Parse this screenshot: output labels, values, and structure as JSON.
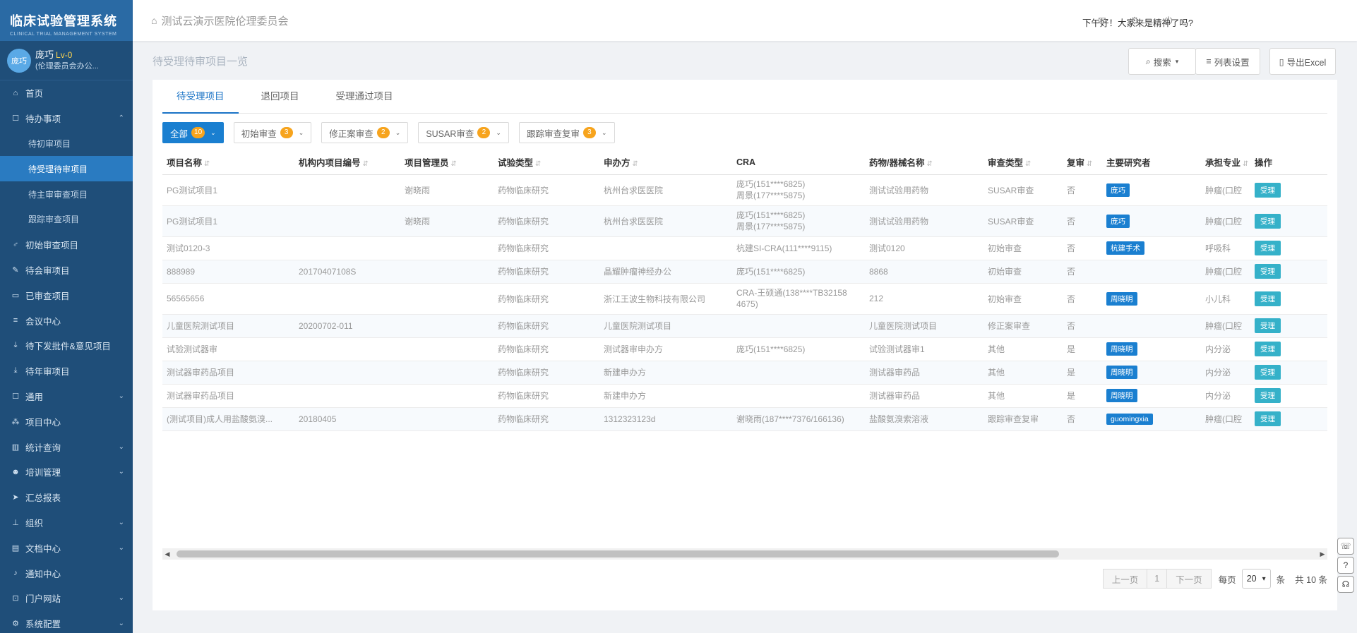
{
  "sidebar": {
    "brand_title": "临床试验管理系统",
    "brand_sub": "CLINICAL TRIAL MANAGEMENT SYSTEM",
    "user": {
      "avatar_text": "庞巧",
      "name": "庞巧",
      "level": "Lv-0",
      "dept": "(伦理委员会办公..."
    },
    "items": [
      {
        "label": "首页",
        "icon": "home-icon",
        "glyph": "⌂",
        "sub": false,
        "active": false,
        "chev": ""
      },
      {
        "label": "待办事项",
        "icon": "calendar-icon",
        "glyph": "☐",
        "sub": false,
        "active": false,
        "chev": "⌃"
      },
      {
        "label": "待初审项目",
        "icon": "",
        "glyph": "",
        "sub": true,
        "active": false,
        "chev": ""
      },
      {
        "label": "待受理待审项目",
        "icon": "",
        "glyph": "",
        "sub": true,
        "active": true,
        "chev": ""
      },
      {
        "label": "待主审审查项目",
        "icon": "",
        "glyph": "",
        "sub": true,
        "active": false,
        "chev": ""
      },
      {
        "label": "跟踪审查项目",
        "icon": "",
        "glyph": "",
        "sub": true,
        "active": false,
        "chev": ""
      },
      {
        "label": "初始审查项目",
        "icon": "male-icon",
        "glyph": "♂",
        "sub": false,
        "active": false,
        "chev": ""
      },
      {
        "label": "待会审项目",
        "icon": "hammer-icon",
        "glyph": "✎",
        "sub": false,
        "active": false,
        "chev": ""
      },
      {
        "label": "已审查项目",
        "icon": "monitor-icon",
        "glyph": "▭",
        "sub": false,
        "active": false,
        "chev": ""
      },
      {
        "label": "会议中心",
        "icon": "list-icon",
        "glyph": "≡",
        "sub": false,
        "active": false,
        "chev": ""
      },
      {
        "label": "待下发批件&意见项目",
        "icon": "download-icon",
        "glyph": "⤓",
        "sub": false,
        "active": false,
        "chev": ""
      },
      {
        "label": "待年审项目",
        "icon": "download-icon",
        "glyph": "⤓",
        "sub": false,
        "active": false,
        "chev": ""
      },
      {
        "label": "通用",
        "icon": "calendar-icon",
        "glyph": "☐",
        "sub": false,
        "active": false,
        "chev": "⌄"
      },
      {
        "label": "项目中心",
        "icon": "cluster-icon",
        "glyph": "⁂",
        "sub": false,
        "active": false,
        "chev": ""
      },
      {
        "label": "统计查询",
        "icon": "chart-icon",
        "glyph": "▥",
        "sub": false,
        "active": false,
        "chev": "⌄"
      },
      {
        "label": "培训管理",
        "icon": "users-icon",
        "glyph": "☻",
        "sub": false,
        "active": false,
        "chev": "⌄"
      },
      {
        "label": "汇总报表",
        "icon": "send-icon",
        "glyph": "➤",
        "sub": false,
        "active": false,
        "chev": ""
      },
      {
        "label": "组织",
        "icon": "sitemap-icon",
        "glyph": "⊥",
        "sub": false,
        "active": false,
        "chev": "⌄"
      },
      {
        "label": "文档中心",
        "icon": "document-icon",
        "glyph": "▤",
        "sub": false,
        "active": false,
        "chev": "⌄"
      },
      {
        "label": "通知中心",
        "icon": "bell-icon",
        "glyph": "♪",
        "sub": false,
        "active": false,
        "chev": ""
      },
      {
        "label": "门户网站",
        "icon": "portal-icon",
        "glyph": "⊡",
        "sub": false,
        "active": false,
        "chev": "⌄"
      },
      {
        "label": "系统配置",
        "icon": "cogs-icon",
        "glyph": "⚙",
        "sub": false,
        "active": false,
        "chev": "⌄"
      }
    ]
  },
  "header": {
    "org": "测试云演示医院伦理委员会",
    "greeting": "下午好！大家来是精神了吗?"
  },
  "page": {
    "title": "待受理待审项目一览",
    "search_label": "搜索",
    "columns_label": "列表设置",
    "export_label": "导出Excel"
  },
  "tabs": [
    "待受理项目",
    "退回项目",
    "受理通过项目"
  ],
  "filters": [
    {
      "label": "全部",
      "count": "10",
      "primary": true
    },
    {
      "label": "初始审查",
      "count": "3",
      "primary": false
    },
    {
      "label": "修正案审查",
      "count": "2",
      "primary": false
    },
    {
      "label": "SUSAR审查",
      "count": "2",
      "primary": false
    },
    {
      "label": "跟踪审查复审",
      "count": "3",
      "primary": false
    }
  ],
  "table": {
    "columns": [
      {
        "label": "项目名称",
        "sort": true
      },
      {
        "label": "机构内项目编号",
        "sort": true
      },
      {
        "label": "项目管理员",
        "sort": true
      },
      {
        "label": "试验类型",
        "sort": true
      },
      {
        "label": "申办方",
        "sort": true
      },
      {
        "label": "CRA",
        "sort": false
      },
      {
        "label": "药物/器械名称",
        "sort": true
      },
      {
        "label": "审查类型",
        "sort": true
      },
      {
        "label": "复审",
        "sort": true
      },
      {
        "label": "主要研究者",
        "sort": false
      },
      {
        "label": "承担专业",
        "sort": true
      },
      {
        "label": "操作",
        "sort": false
      }
    ],
    "rows": [
      [
        "PG测试项目1",
        "",
        "谢晓雨",
        "药物临床研究",
        "杭州台求医医院",
        "庞巧(151****6825)\n周景(177****5875)",
        "测试试验用药物",
        "SUSAR审查",
        "否",
        "庞巧",
        "肿瘤(口腔",
        "受理"
      ],
      [
        "PG测试项目1",
        "",
        "谢晓雨",
        "药物临床研究",
        "杭州台求医医院",
        "庞巧(151****6825)\n周景(177****5875)",
        "测试试验用药物",
        "SUSAR审查",
        "否",
        "庞巧",
        "肿瘤(口腔",
        "受理"
      ],
      [
        "测试0120-3",
        "",
        "",
        "药物临床研究",
        "",
        "杭建SI-CRA(111****9115)",
        "测试0120",
        "初始审查",
        "否",
        "杭建手术",
        "呼吸科",
        "受理"
      ],
      [
        "888989",
        "20170407108S",
        "",
        "药物临床研究",
        "晶耀肿瘤神经办公",
        "庞巧(151****6825)",
        "8868",
        "初始审查",
        "否",
        "",
        "肿瘤(口腔",
        "受理"
      ],
      [
        "56565656",
        "",
        "",
        "药物临床研究",
        "浙江王波生物科技有限公司",
        "CRA-王硕通(138****TB32158\n4675)",
        "212",
        "初始审查",
        "否",
        "周晓明",
        "小儿科",
        "受理"
      ],
      [
        "儿童医院测试项目",
        "20200702-011",
        "",
        "药物临床研究",
        "儿童医院测试项目",
        "",
        "儿童医院测试项目",
        "修正案审查",
        "否",
        "",
        "肿瘤(口腔",
        "受理"
      ],
      [
        "试验测试器审",
        "",
        "",
        "药物临床研究",
        "测试器审申办方",
        "庞巧(151****6825)",
        "试验测试器审1",
        "其他",
        "是",
        "周晓明",
        "内分泌",
        "受理"
      ],
      [
        "测试器审药品项目",
        "",
        "",
        "药物临床研究",
        "新建申办方",
        "",
        "测试器审药品",
        "其他",
        "是",
        "周晓明",
        "内分泌",
        "受理"
      ],
      [
        "测试器审药品项目",
        "",
        "",
        "药物临床研究",
        "新建申办方",
        "",
        "测试器审药品",
        "其他",
        "是",
        "周晓明",
        "内分泌",
        "受理"
      ],
      [
        "(测试项目)成人用盐酸氨溴...",
        "20180405",
        "",
        "药物临床研究",
        "1312323123d",
        "谢晓雨(187****7376/166136)",
        "盐酸氨溴索溶液",
        "跟踪审查复审",
        "否",
        "guomingxia",
        "肿瘤(口腔",
        "受理"
      ]
    ]
  },
  "pager": {
    "prev": "上一页",
    "page": "1",
    "next": "下一页",
    "per_page_label": "每页",
    "per_page": "20",
    "unit": "条",
    "total": "共 10 条"
  }
}
